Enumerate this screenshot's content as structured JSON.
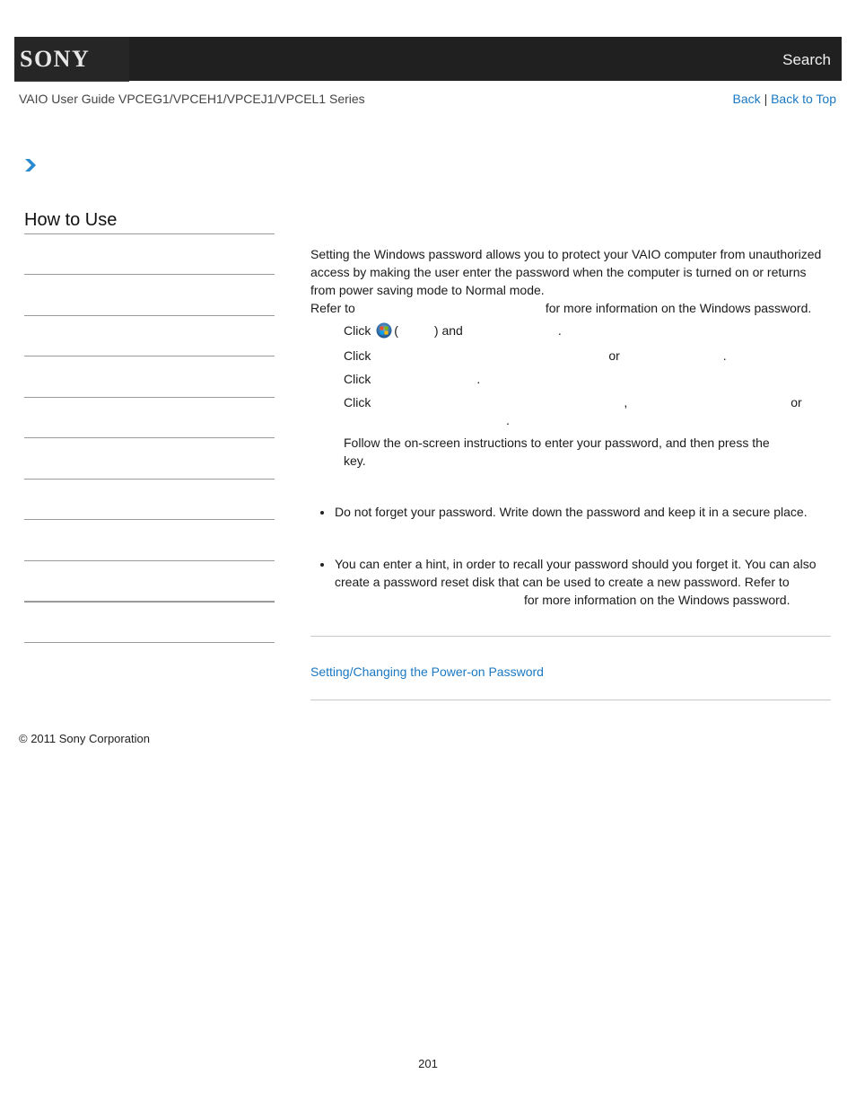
{
  "header": {
    "brand": "SONY",
    "search_label": "Search"
  },
  "subheader": {
    "guide_title": "VAIO User Guide VPCEG1/VPCEH1/VPCEJ1/VPCEL1 Series",
    "back_label": "Back",
    "separator": "|",
    "back_to_top_label": "Back to Top"
  },
  "breadcrumb": {
    "icon": "chevron-right-icon"
  },
  "sidebar": {
    "title": "How to Use",
    "items": [
      {
        "label": ""
      },
      {
        "label": ""
      },
      {
        "label": ""
      },
      {
        "label": ""
      },
      {
        "label": ""
      },
      {
        "label": ""
      },
      {
        "label": ""
      },
      {
        "label": ""
      },
      {
        "label": ""
      },
      {
        "label": ""
      }
    ]
  },
  "main": {
    "intro": "Setting the Windows password allows you to protect your VAIO computer from unauthorized access by making the user enter the password when the computer is turned on or returns from power saving mode to Normal mode.",
    "refer_prefix": "Refer to",
    "refer_suffix": "for more information on the Windows password.",
    "steps": [
      {
        "prefix": "Click",
        "icon": "windows-start-icon",
        "paren_open": "(",
        "paren_close": ") and",
        "end": "."
      },
      {
        "prefix": "Click",
        "mid": "or",
        "end": "."
      },
      {
        "prefix": "Click",
        "end": "."
      },
      {
        "prefix": "Click",
        "comma": ",",
        "mid": "or",
        "end": "."
      },
      {
        "text": "Follow the on-screen instructions to enter your password, and then press the",
        "text2": "key."
      }
    ],
    "notes": [
      {
        "text": "Do not forget your password. Write down the password and keep it in a secure place."
      }
    ],
    "hints": [
      {
        "text": "You can enter a hint, in order to recall your password should you forget it. You can also create a password reset disk that can be used to create a new password. Refer to",
        "suffix": "for more information on the Windows password."
      }
    ],
    "related_link": "Setting/Changing the Power-on Password"
  },
  "footer": {
    "copyright": "© 2011 Sony Corporation",
    "page_number": "201"
  },
  "colors": {
    "header_bg": "#202020",
    "link": "#1a78c2",
    "divider": "#9a9a9a"
  }
}
